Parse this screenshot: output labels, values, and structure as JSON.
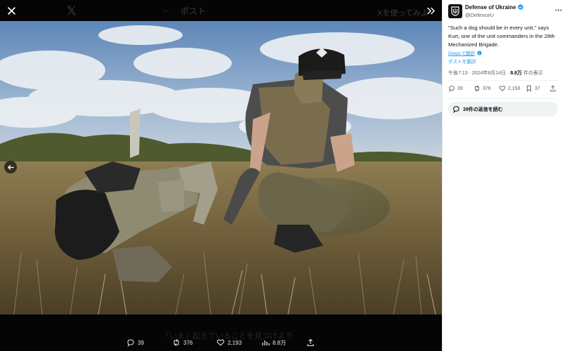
{
  "viewer": {
    "header": {
      "logo": "𝕏",
      "back": "←",
      "title": "ポスト",
      "cta": "Xを使ってみよ"
    },
    "bottom_ghost_text": "「いま」起きていることを見つけよう",
    "actions": {
      "replies": "39",
      "reposts": "376",
      "likes": "2,193",
      "views": "8.8万"
    }
  },
  "tweet": {
    "author_name": "Defense of Ukraine",
    "author_handle": "@DefenceU",
    "text": "\"Such a dog should be in every unit,\" says Kurt, one of the unit commanders in the 28th Mechanized Brigade.",
    "translation_by": "DeepLで翻訳",
    "translate_link": "ポストを翻訳",
    "timestamp": "午後7:13 · 2024年8月14日 · ",
    "views_value": "8.8万",
    "views_label": " 件の表示",
    "stats": {
      "replies": "39",
      "reposts": "376",
      "likes": "2,193",
      "bookmarks": "37"
    },
    "read_replies": "39件の返信を読む"
  },
  "colors": {
    "accent": "#1d9bf0",
    "text_primary": "#0f1419",
    "text_secondary": "#536471",
    "viewer_bg": "#050505"
  },
  "icons": [
    "close-icon",
    "expand-icon",
    "arrow-left-icon",
    "reply-icon",
    "repost-icon",
    "like-icon",
    "views-icon",
    "share-icon",
    "bookmark-icon",
    "more-icon",
    "verified-badge-icon"
  ]
}
